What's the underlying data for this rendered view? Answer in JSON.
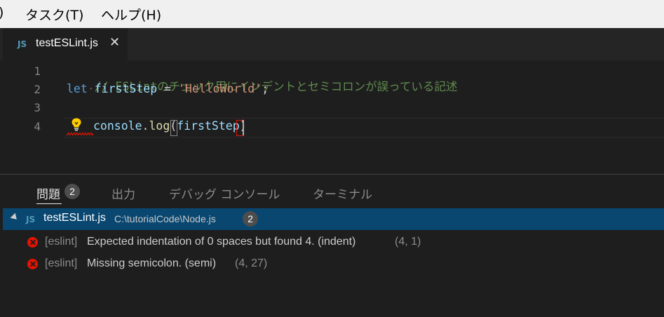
{
  "menu": {
    "items": [
      {
        "label": ")"
      },
      {
        "label": "タスク(T)"
      },
      {
        "label": "ヘルプ(H)"
      }
    ]
  },
  "tab": {
    "icon": "JS",
    "filename": "testESLint.js",
    "close": "✕"
  },
  "editor": {
    "lines": [
      {
        "number": "1",
        "comment": "// ESLintのチェック用にインデントとセミコロンが誤っている記述"
      },
      {
        "number": "2",
        "kw": "let",
        "var": "firstStep",
        "op": " = ",
        "str": "'HelloWorld'",
        "end": ";"
      },
      {
        "number": "3"
      },
      {
        "number": "4",
        "obj": "console",
        "dot": ".",
        "fn": "log",
        "open": "(",
        "arg": "firstStep",
        "close": ")"
      }
    ],
    "lightbulb": "lightbulb-icon"
  },
  "panel": {
    "tabs": [
      {
        "label": "問題",
        "badge": "2"
      },
      {
        "label": "出力"
      },
      {
        "label": "デバッグ コンソール"
      },
      {
        "label": "ターミナル"
      }
    ],
    "file": {
      "icon": "JS",
      "name": "testESLint.js",
      "path": "C:\\tutorialCode\\Node.js",
      "count": "2"
    },
    "problems": [
      {
        "source": "[eslint]",
        "message": "Expected indentation of 0 spaces but found 4. (indent)",
        "position": "(4, 1)"
      },
      {
        "source": "[eslint]",
        "message": "Missing semicolon. (semi)",
        "position": "(4, 27)"
      }
    ]
  },
  "colors": {
    "editor_bg": "#1e1e1e",
    "selection": "#094771",
    "error": "#e51400",
    "comment": "#608b4e",
    "keyword": "#569cd6",
    "string": "#ce9178"
  }
}
